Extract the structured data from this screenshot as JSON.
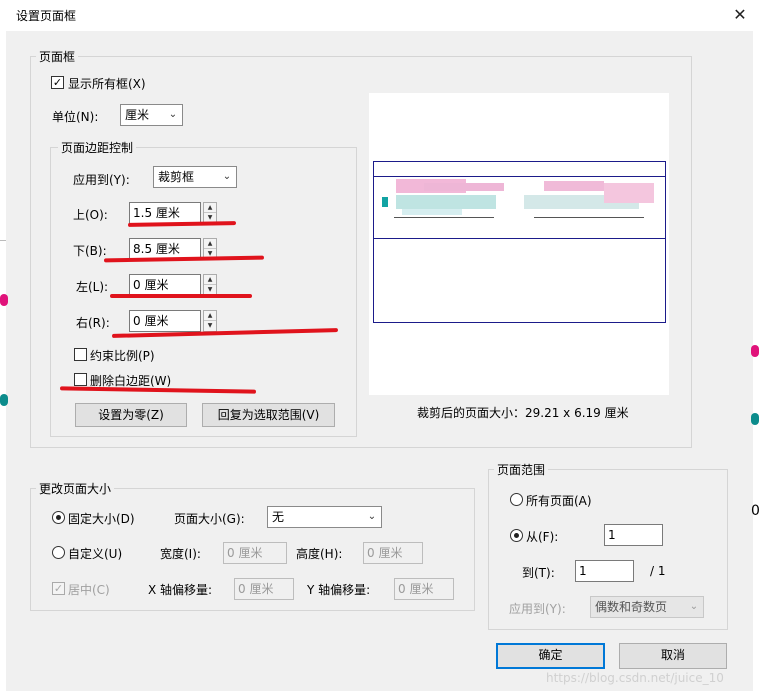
{
  "window": {
    "title": "设置页面框",
    "close_icon": "close-icon"
  },
  "page_box": {
    "group_label": "页面框",
    "show_all_boxes": {
      "label": "显示所有框(X)",
      "checked": true
    },
    "unit": {
      "label": "单位(N):",
      "value": "厘米"
    },
    "margin_control": {
      "group_label": "页面边距控制",
      "apply_to": {
        "label": "应用到(Y):",
        "value": "裁剪框"
      },
      "top": {
        "label": "上(O):",
        "value": "1.5 厘米"
      },
      "bottom": {
        "label": "下(B):",
        "value": "8.5 厘米"
      },
      "left": {
        "label": "左(L):",
        "value": "0 厘米"
      },
      "right": {
        "label": "右(R):",
        "value": "0 厘米"
      },
      "constrain_proportions": {
        "label": "约束比例(P)",
        "checked": false
      },
      "remove_white_margins": {
        "label": "删除白边距(W)",
        "checked": false
      },
      "set_to_zero_button": "设置为零(Z)",
      "revert_button": "回复为选取范围(V)"
    },
    "preview_caption": "裁剪后的页面大小：29.21 x 6.19 厘米"
  },
  "change_page_size": {
    "group_label": "更改页面大小",
    "fixed_size": {
      "label": "固定大小(D)",
      "selected": true
    },
    "page_size": {
      "label": "页面大小(G):",
      "value": "无"
    },
    "custom": {
      "label": "自定义(U)",
      "selected": false
    },
    "width": {
      "label": "宽度(I):",
      "value": "0 厘米"
    },
    "height": {
      "label": "高度(H):",
      "value": "0 厘米"
    },
    "center": {
      "label": "居中(C)",
      "checked": true
    },
    "x_offset": {
      "label": "X 轴偏移量:",
      "value": "0 厘米"
    },
    "y_offset": {
      "label": "Y 轴偏移量:",
      "value": "0 厘米"
    }
  },
  "page_range": {
    "group_label": "页面范围",
    "all_pages": {
      "label": "所有页面(A)",
      "selected": false
    },
    "from": {
      "label": "从(F):",
      "value": "1",
      "selected": true
    },
    "to": {
      "label": "到(T):",
      "value": "1",
      "total": "/ 1"
    },
    "apply_to": {
      "label": "应用到(Y):",
      "value": "偶数和奇数页"
    }
  },
  "buttons": {
    "ok": "确定",
    "cancel": "取消"
  },
  "watermark": "https://blog.csdn.net/juice_10",
  "colors": {
    "annotation_red": "#e0131c",
    "focus_blue": "#0078d7",
    "preview_frame": "#1b1b8a"
  }
}
